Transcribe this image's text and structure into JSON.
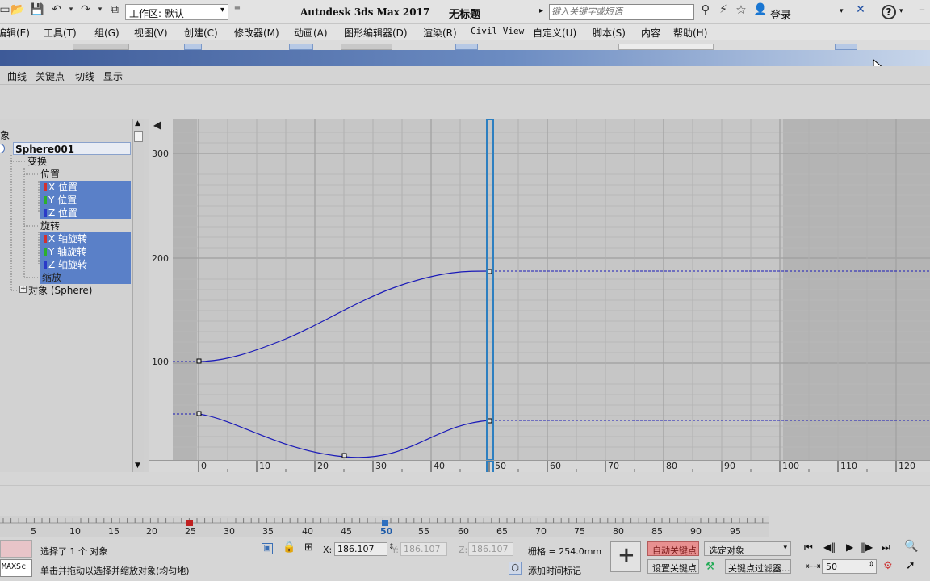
{
  "app": {
    "title": "Autodesk 3ds Max 2017",
    "doc_title": "无标题",
    "workspace": "工作区: 默认",
    "search_placeholder": "键入关键字或短语",
    "login": "登录"
  },
  "menu": [
    "编辑(E)",
    "工具(T)",
    "组(G)",
    "视图(V)",
    "创建(C)",
    "修改器(M)",
    "动画(A)",
    "图形编辑器(D)",
    "渲染(R)",
    "Civil View",
    "自定义(U)",
    "脚本(S)",
    "内容",
    "帮助(H)"
  ],
  "track_editor_menu": [
    "曲线",
    "关键点",
    "切线",
    "显示"
  ],
  "tree": {
    "partial_label": "象",
    "object": "Sphere001",
    "transform": "变换",
    "position": "位置",
    "x_pos": "X 位置",
    "y_pos": "Y 位置",
    "z_pos": "Z 位置",
    "rotation": "旋转",
    "x_rot": "X 轴旋转",
    "y_rot": "Y 轴旋转",
    "z_rot": "Z 轴旋转",
    "scale": "缩放",
    "object_sphere": "对象 (Sphere)"
  },
  "graph": {
    "y_ticks": [
      "300",
      "200",
      "100"
    ],
    "x_ticks": [
      "0",
      "10",
      "20",
      "30",
      "40",
      "50",
      "60",
      "70",
      "80",
      "90",
      "100",
      "110",
      "120"
    ]
  },
  "timeline": {
    "ticks": [
      "5",
      "10",
      "15",
      "20",
      "25",
      "30",
      "35",
      "40",
      "45",
      "50",
      "55",
      "60",
      "65",
      "70",
      "75",
      "80",
      "85",
      "90",
      "95"
    ],
    "current_frame": "50"
  },
  "status": {
    "maxscript": "MAXSc",
    "selected": "选择了 1 个 对象",
    "hint": "单击并拖动以选择并缩放对象(均匀地)",
    "x_label": "X:",
    "x_value": "186.107",
    "y_label": "Y:",
    "y_value": "186.107",
    "z_label": "Z:",
    "z_value": "186.107",
    "grid": "栅格 = 254.0mm",
    "add_time_tag": "添加时间标记",
    "auto_key": "自动关键点",
    "set_key": "设置关键点",
    "selected_object": "选定对象",
    "key_filters": "关键点过滤器..."
  },
  "colors": {
    "selection": "#5a80c8",
    "curve": "#1a1ab8",
    "time_slider": "#2d7fc0",
    "auto_key_bg": "#e89090"
  }
}
